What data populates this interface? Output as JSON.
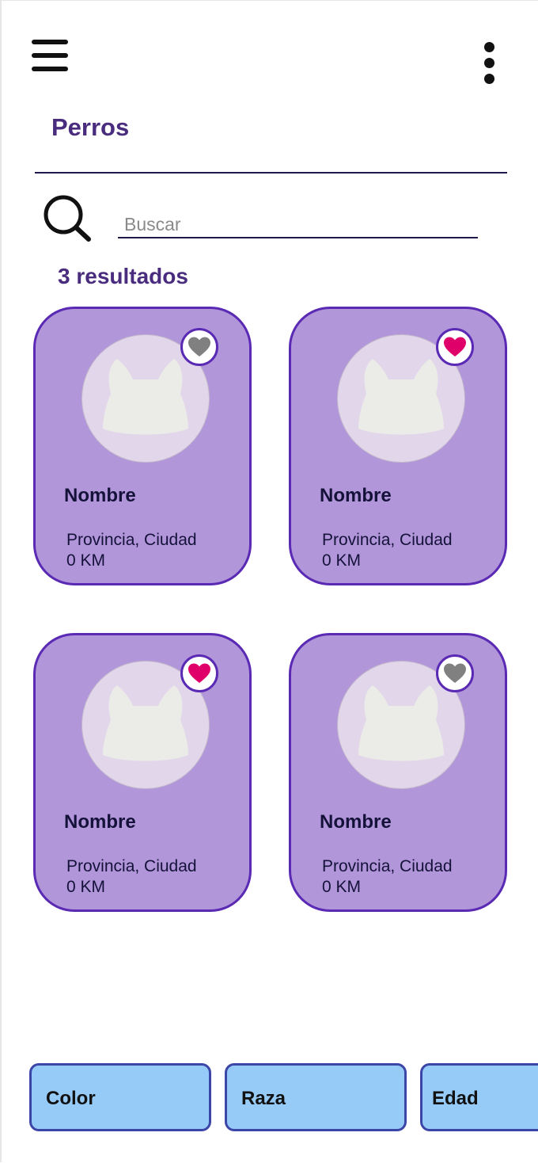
{
  "header": {
    "title": "Perros",
    "menu_icon": "hamburger-menu-icon",
    "more_icon": "more-vertical-icon"
  },
  "search": {
    "placeholder": "Buscar",
    "value": "",
    "icon": "search-icon"
  },
  "results": {
    "count_label": "3 resultados"
  },
  "cards": [
    {
      "name": "Nombre",
      "location": "Provincia, Ciudad",
      "distance": "0 KM",
      "favorite": false
    },
    {
      "name": "Nombre",
      "location": "Provincia, Ciudad",
      "distance": "0 KM",
      "favorite": true
    },
    {
      "name": "Nombre",
      "location": "Provincia, Ciudad",
      "distance": "0 KM",
      "favorite": true
    },
    {
      "name": "Nombre",
      "location": "Provincia, Ciudad",
      "distance": "0 KM",
      "favorite": false
    }
  ],
  "filters": [
    {
      "label": "Color"
    },
    {
      "label": "Raza"
    },
    {
      "label": "Edad"
    }
  ],
  "colors": {
    "title": "#4a2c7e",
    "card_bg": "#b196da",
    "card_border": "#5a2ab4",
    "heart_active": "#e0006a",
    "heart_inactive": "#808080",
    "filter_bg": "#97cbf7",
    "filter_border": "#3b46a8"
  }
}
